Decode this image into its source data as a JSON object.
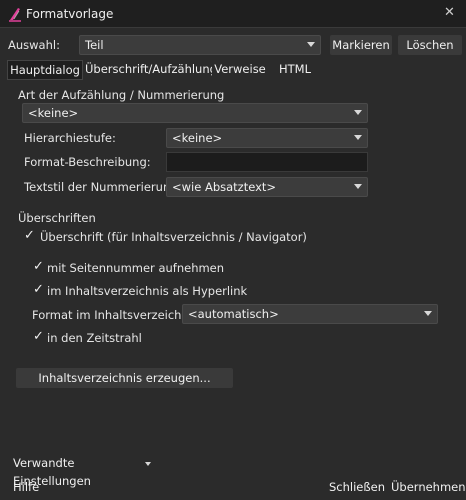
{
  "window": {
    "title": "Formatvorlage",
    "close_glyph": "✕"
  },
  "toolbar": {
    "select_label": "Auswahl:",
    "select_value": "Teil",
    "mark_button": "Markieren",
    "delete_button": "Löschen"
  },
  "tabs": [
    "Hauptdialog",
    "Überschrift/Aufzählung",
    "Verweise",
    "HTML"
  ],
  "numbering": {
    "section_title": "Art der Aufzählung / Nummerierung",
    "type_value": "<keine>",
    "level_label": "Hierarchiestufe:",
    "level_value": "<keine>",
    "format_desc_label": "Format-Beschreibung:",
    "format_desc_value": "",
    "textstyle_label": "Textstil der Nummerierung:",
    "textstyle_value": "<wie Absatztext>"
  },
  "headings": {
    "section_title": "Überschriften",
    "toc_heading": "Überschrift (für Inhaltsverzeichnis / Navigator)",
    "page_number": "mit Seitennummer aufnehmen",
    "hyperlink": "im Inhaltsverzeichnis als Hyperlink",
    "format_label": "Format im Inhaltsverzeichnis:",
    "format_value": "<automatisch>",
    "timeline": "in den Zeitstrahl",
    "generate_button": "Inhaltsverzeichnis erzeugen..."
  },
  "footer": {
    "related_settings": "Verwandte Einstellungen",
    "help": "Hilfe",
    "close": "Schließen",
    "apply": "Übernehmen"
  },
  "check_glyph": "✓",
  "colors": {
    "background": "#2b2b2b",
    "titlebar": "#1f1f1f",
    "control": "#3c3c3c",
    "accent": "#e0409a"
  }
}
